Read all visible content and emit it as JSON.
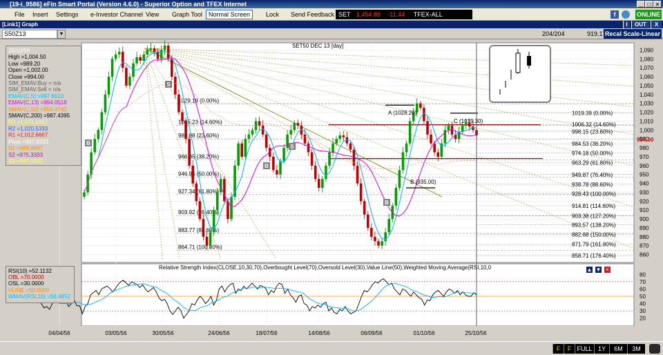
{
  "window": {
    "title": "[19-i_9586] eFin Smart Portal (Version 4.6.0) - Superior Option and TFEX Internet"
  },
  "menu": {
    "items": [
      "File",
      "Insert",
      "Settings",
      "e-Investor Channel",
      "View",
      "Graph Tool",
      "Normal Screen",
      "Lock",
      "Send Feedback"
    ],
    "active": "Normal Screen"
  },
  "ticker": {
    "index_label": "SET",
    "index_value": "1,454.88",
    "change": "-11.44",
    "market": "TFEX-ALL"
  },
  "status": {
    "online": "ONLINE"
  },
  "link": {
    "title": "[Link1] Graph",
    "i": "I",
    "out": "OUT",
    "x": "X"
  },
  "toolbar": {
    "symbol": "S50Z13",
    "counter": "204/204",
    "last_value": "919.17",
    "scale_button": "Recal Scale-Linear"
  },
  "info": [
    {
      "text": "25/10/56",
      "color": "#ffffff"
    },
    {
      "text": "High =1,004.50",
      "color": "#000000"
    },
    {
      "text": "Low =989.20",
      "color": "#000000"
    },
    {
      "text": "Open =1,002.00",
      "color": "#000000"
    },
    {
      "text": "Close =994.00",
      "color": "#000000"
    },
    {
      "text": "SIM_EMAV.Buy = n/a",
      "color": "#606060"
    },
    {
      "text": "SIM_EMAV.Sell = n/a",
      "color": "#606060"
    },
    {
      "text": "EMAV(C,5) =997.6610",
      "color": "#00c0ff"
    },
    {
      "text": "EMAV(C,13) =994.0518",
      "color": "#e000e0"
    },
    {
      "text": "SMAV(C,50) =956.0740",
      "color": "#ff8c00"
    },
    {
      "text": "SMAV(C,200) =987.4395",
      "color": "#000000"
    },
    {
      "text": "R3 =1,031.1667",
      "color": "#ffff60"
    },
    {
      "text": "R2 =1,020.5333",
      "color": "#2060ff"
    },
    {
      "text": "R1 =1,012.6667",
      "color": "#ff2020"
    },
    {
      "text": "Pivot =997.9333",
      "color": "#ffffff"
    },
    {
      "text": "S1 =989.6667",
      "color": "#ff8c00"
    },
    {
      "text": "S2 =975.3333",
      "color": "#a020a0"
    },
    {
      "text": "S3 =967.0333",
      "color": "#ffff60"
    }
  ],
  "rsi": {
    "title": "Relative Strength Index(CLOSE,10,30,70),Overbought Level(70),Oversold Level(30),Value Line(50),Weighted Moving Average(RSI,10,0",
    "legend": [
      {
        "text": "RSI(10) =52.1132",
        "color": "#000000"
      },
      {
        "text": "OBL =70.0000",
        "color": "#cc0000"
      },
      {
        "text": "OSL =30.0000",
        "color": "#000000"
      },
      {
        "text": "VLINE =50.0000",
        "color": "#ff8c00"
      },
      {
        "text": "WMAV(RSI,10) =56.4852",
        "color": "#00c0ff"
      }
    ],
    "yticks": [
      80,
      70,
      60,
      50,
      40,
      30,
      20
    ],
    "series": [
      52,
      55,
      50,
      42,
      46,
      40,
      34,
      36,
      32,
      40,
      44,
      46,
      40,
      45,
      43,
      36,
      40,
      45,
      37,
      37,
      26,
      36,
      40,
      52,
      55,
      58,
      52,
      60,
      62,
      64,
      61,
      56,
      60,
      66,
      70,
      72,
      68,
      65,
      70,
      68,
      66,
      62,
      66,
      60,
      56,
      59,
      62,
      56,
      48,
      44,
      46,
      40,
      30,
      25,
      30,
      35,
      30,
      20,
      25,
      30,
      40,
      38,
      45,
      50,
      46,
      40,
      44,
      50,
      38,
      45,
      60,
      64,
      56,
      62,
      66,
      68,
      54,
      60,
      58,
      64,
      60,
      64,
      68,
      64,
      60,
      65,
      63,
      61,
      52,
      58,
      55,
      64,
      68,
      66,
      54,
      60,
      52,
      48,
      42,
      50,
      52,
      40,
      38,
      30,
      36,
      34,
      38,
      35,
      40,
      42,
      30,
      34,
      28,
      26,
      32,
      30,
      36,
      30,
      26,
      28,
      30,
      40,
      50,
      58,
      56,
      60,
      66,
      70,
      68,
      72,
      74,
      70,
      66,
      68,
      60,
      56,
      52,
      60,
      58,
      54,
      50,
      56,
      52,
      48,
      46,
      38,
      45,
      44,
      52,
      56,
      58,
      54,
      50,
      56,
      60,
      58,
      54,
      58,
      52,
      56,
      52,
      50,
      50,
      55,
      52
    ]
  },
  "chart_data": {
    "type": "candlestick",
    "title": "SET50 DEC 13",
    "period": "[day]",
    "x_ticks": [
      "04/04/56",
      "03/05/56",
      "30/05/56",
      "24/06/56",
      "18/07/56",
      "14/08/56",
      "06/09/56",
      "01/10/56",
      "25/10/56"
    ],
    "y_ticks": [
      "1,090",
      "1,080",
      "1,070",
      "1,060",
      "1,050",
      "1,040",
      "1,030",
      "1,020",
      "1,010",
      "1,000",
      "990",
      "980",
      "970",
      "960",
      "950",
      "940",
      "930",
      "920",
      "910",
      "900",
      "890",
      "880",
      "870",
      "860"
    ],
    "last_price": "994.00",
    "close_series": [
      930,
      950,
      975,
      990,
      1000,
      1020,
      1040,
      1060,
      1080,
      1085,
      1088,
      1070,
      1050,
      1060,
      1075,
      1082,
      1078,
      1085,
      1090,
      1092,
      1088,
      1080,
      1090,
      1095,
      1080,
      1060,
      1040,
      1020,
      1010,
      990,
      960,
      940,
      920,
      900,
      880,
      870,
      885,
      910,
      930,
      945,
      920,
      900,
      925,
      960,
      985,
      970,
      990,
      995,
      1000,
      1010,
      1005,
      995,
      980,
      970,
      955,
      950,
      965,
      980,
      995,
      1000,
      1008,
      1005,
      995,
      985,
      975,
      960,
      945,
      935,
      945,
      960,
      975,
      985,
      990,
      994,
      992,
      985,
      978,
      960,
      940,
      920,
      905,
      890,
      880,
      875,
      870,
      875,
      885,
      900,
      915,
      935,
      955,
      975,
      985,
      1010,
      1020,
      1030,
      1025,
      1010,
      995,
      985,
      975,
      970,
      985,
      1000,
      1005,
      995,
      990,
      998,
      1005,
      1008,
      1004,
      1000,
      994
    ],
    "fib_levels": [
      "1029.19 (0.00%)",
      "1005.23 (14.60%)",
      "989.98 (23.60%)",
      "966.35 (38.20%)",
      "946.95 (50.00%)",
      "927.34 (61.80%)",
      "903.92 (76.40%)",
      "883.77 (88.60%)",
      "864.71 (100.00%)"
    ],
    "fib_levels_right": [
      "1019.39 (0.00%)",
      "1006.32 (14.60%)",
      "998.15 (23.60%)",
      "984.53 (38.20%)",
      "974.18 (50.00%)",
      "963.29 (61.80%)",
      "949.87 (76.40%)",
      "938.78 (88.60%)",
      "928.43 (100.00%)",
      "914.81 (114.60%)",
      "903.38 (127.20%)",
      "893.57 (138.20%)",
      "882.68 (150.00%)",
      "871.79 (161.80%)",
      "858.71 (176.40%)"
    ],
    "annotations": [
      "A (1028.20)",
      "B (935.00)",
      "C (1019.30)"
    ],
    "signal_markers": [
      "B",
      "S",
      "B",
      "S",
      "B"
    ]
  },
  "timeframes": [
    "F",
    "F",
    "FULL",
    "1Y",
    "6M",
    "3M"
  ]
}
